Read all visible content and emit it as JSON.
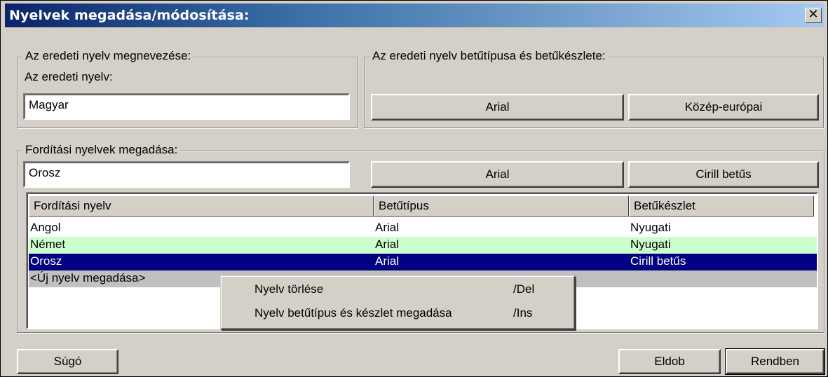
{
  "window": {
    "title": "Nyelvek megadása/módosítása:",
    "close_glyph": "✕"
  },
  "original_group": {
    "legend": "Az eredeti nyelv megnevezése:",
    "label": "Az eredeti nyelv:",
    "value": "Magyar"
  },
  "font_group": {
    "legend": "Az eredeti nyelv betűtípusa és betűkészlete:",
    "font_button": "Arial",
    "charset_button": "Közép-európai"
  },
  "translation_group": {
    "legend": "Fordítási nyelvek megadása:",
    "value": "Orosz",
    "font_button": "Arial",
    "charset_button": "Cirill betűs"
  },
  "list": {
    "columns": [
      "Fordítási nyelv",
      "Betűtípus",
      "Betűkészlet"
    ],
    "rows": [
      {
        "language": "Angol",
        "font": "Arial",
        "charset": "Nyugati"
      },
      {
        "language": "Német",
        "font": "Arial",
        "charset": "Nyugati"
      },
      {
        "language": "Orosz",
        "font": "Arial",
        "charset": "Cirill betűs"
      },
      {
        "language": "<Új nyelv megadása>",
        "font": "",
        "charset": ""
      }
    ]
  },
  "context_menu": {
    "items": [
      {
        "label": "Nyelv törlése",
        "shortcut": "/Del"
      },
      {
        "label": "Nyelv betűtípus és készlet megadása",
        "shortcut": "/Ins"
      }
    ]
  },
  "footer": {
    "help": "Súgó",
    "cancel": "Eldob",
    "ok": "Rendben"
  },
  "colors": {
    "title_gradient_start": "#0a246a",
    "title_gradient_end": "#a6caf0",
    "dialog_face": "#d4d0c8",
    "row_alternate": "#ccffcc",
    "row_selected": "#000080",
    "row_new": "#c0c0c0"
  }
}
